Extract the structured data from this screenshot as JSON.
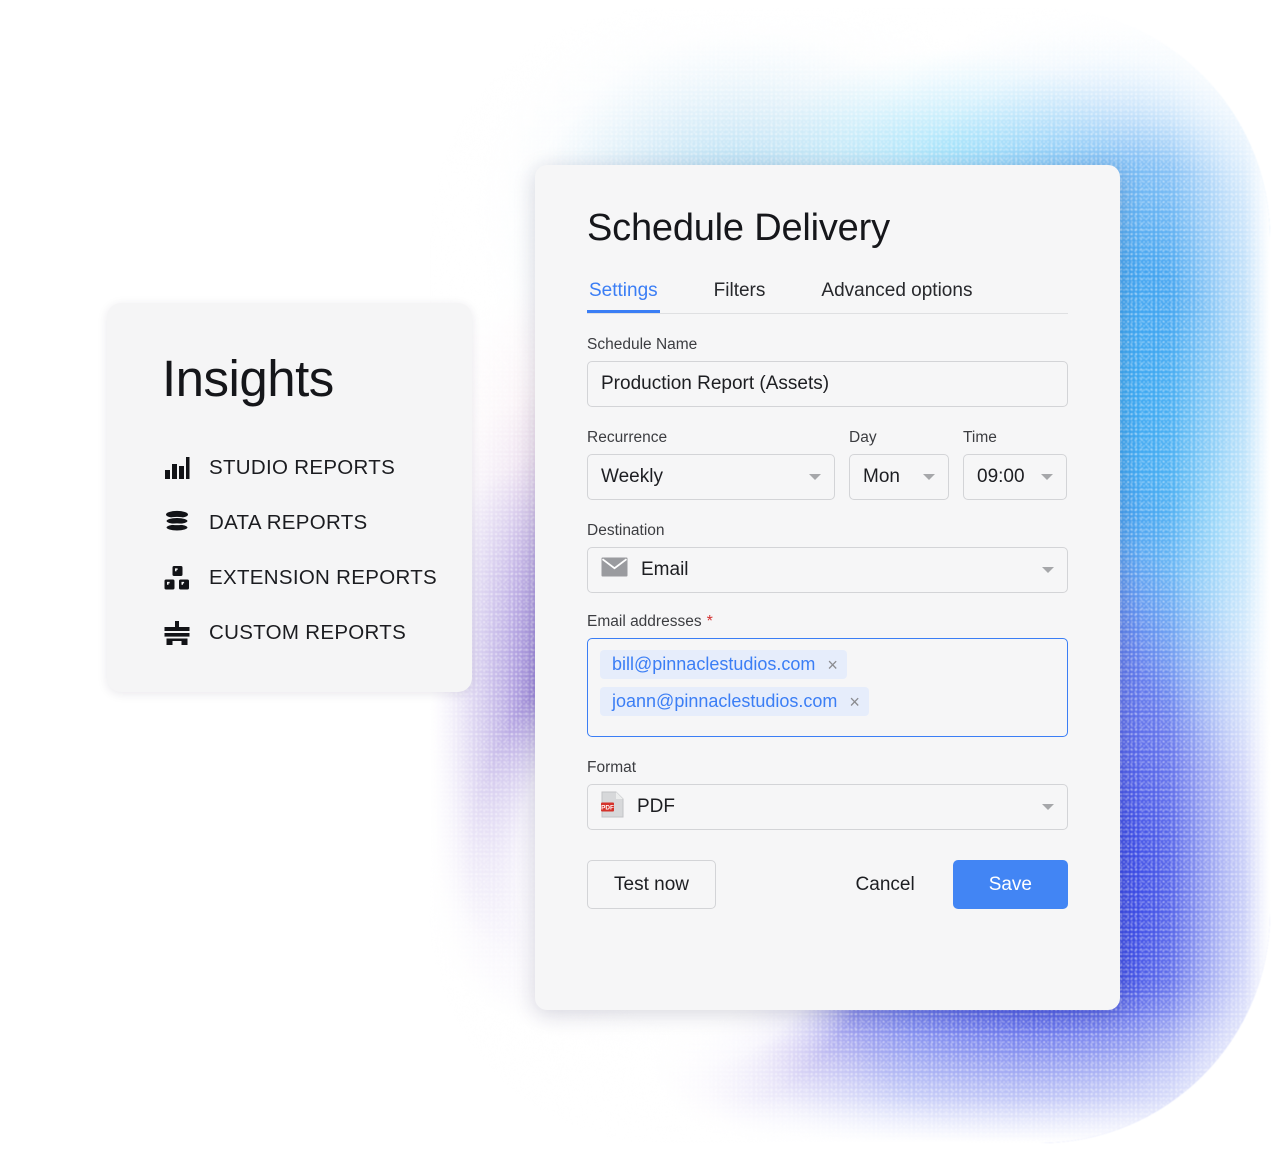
{
  "insights": {
    "title": "Insights",
    "items": [
      {
        "label": "STUDIO REPORTS",
        "icon": "bar-chart-icon"
      },
      {
        "label": "DATA REPORTS",
        "icon": "database-icon"
      },
      {
        "label": "EXTENSION REPORTS",
        "icon": "blocks-icon"
      },
      {
        "label": "CUSTOM REPORTS",
        "icon": "custom-report-icon"
      }
    ]
  },
  "dialog": {
    "title": "Schedule Delivery",
    "tabs": [
      {
        "label": "Settings",
        "active": true
      },
      {
        "label": "Filters",
        "active": false
      },
      {
        "label": "Advanced options",
        "active": false
      }
    ],
    "schedule_name": {
      "label": "Schedule Name",
      "value": "Production Report (Assets)",
      "placeholder": "Schedule Name"
    },
    "recurrence": {
      "label": "Recurrence",
      "value": "Weekly"
    },
    "day": {
      "label": "Day",
      "value": "Mon"
    },
    "time": {
      "label": "Time",
      "value": "09:00"
    },
    "destination": {
      "label": "Destination",
      "value": "Email",
      "icon": "envelope-icon"
    },
    "email_addresses": {
      "label": "Email addresses",
      "required_marker": "*",
      "chips": [
        {
          "email": "bill@pinnaclestudios.com",
          "remove": "×"
        },
        {
          "email": "joann@pinnaclestudios.com",
          "remove": "×"
        }
      ]
    },
    "format": {
      "label": "Format",
      "value": "PDF",
      "icon": "pdf-file-icon",
      "badge_text": "PDF"
    },
    "actions": {
      "test_now": "Test now",
      "cancel": "Cancel",
      "save": "Save"
    }
  },
  "colors": {
    "accent_blue": "#4285f4",
    "tab_active": "#3b7ef5",
    "chip_bg": "#e6edfb",
    "chip_text": "#3b7ef5",
    "required_star": "#d32f2f",
    "pdf_badge": "#d32f2f",
    "card_bg": "#f6f6f7"
  }
}
